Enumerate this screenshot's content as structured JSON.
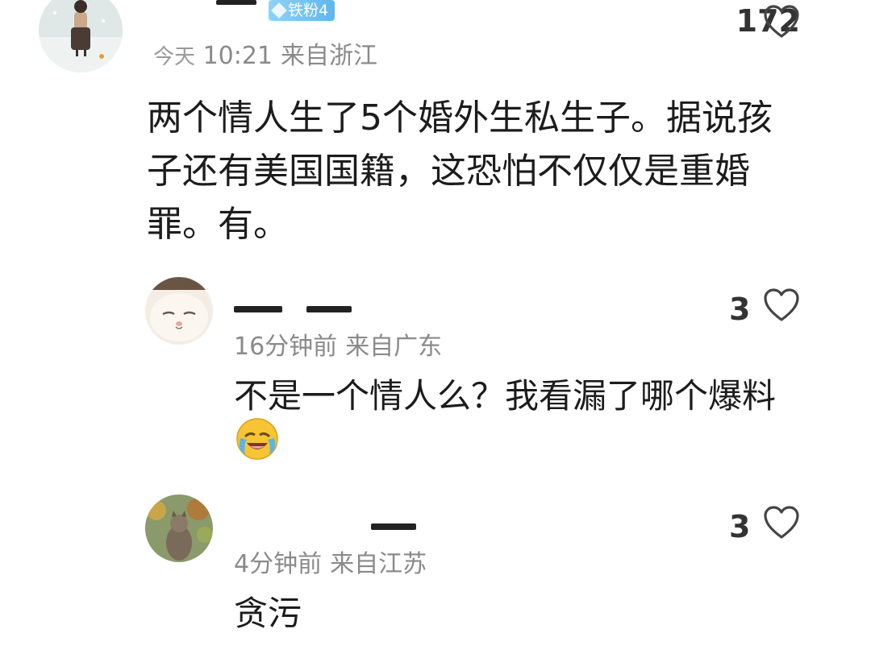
{
  "comments": [
    {
      "badge": "铁粉4",
      "time": "10:21",
      "time_prefix": "今天",
      "location": "来自浙江",
      "likes": "172",
      "lines": [
        "两个情人生了5个婚外生私生子。据说孩",
        "子还有美国国籍，这恐怕不仅仅是重婚",
        "罪。有。"
      ]
    },
    {
      "time": "16分钟前",
      "location": "来自广东",
      "likes": "3",
      "lines": [
        "不是一个情人么？我看漏了哪个爆料"
      ],
      "emoji": "laughing-crying-emoji"
    },
    {
      "time": "4分钟前",
      "location": "来自江苏",
      "likes": "3",
      "lines": [
        "贪污"
      ]
    }
  ],
  "colors": {
    "meta": "#8a8a8a",
    "text": "#1c1c1c",
    "badge": "#6cc0f0",
    "heart": "#444444"
  },
  "icons": {
    "like": "heart-outline-icon",
    "badge": "diamond-icon"
  }
}
